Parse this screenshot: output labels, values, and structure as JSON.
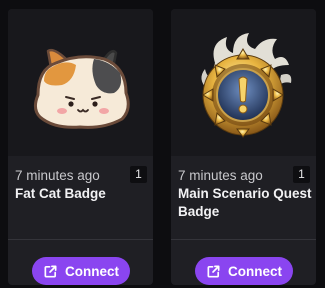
{
  "colors": {
    "background": "#0d0d10",
    "card": "#1f1f24",
    "accent": "#8a45f0"
  },
  "cards": [
    {
      "time": "7 minutes ago",
      "count": "1",
      "title": "Fat Cat Badge",
      "image_icon": "fat-cat-badge-icon",
      "button_icon": "external-link-icon",
      "button_label": "Connect"
    },
    {
      "time": "7 minutes ago",
      "count": "1",
      "title": "Main Scenario Quest Badge",
      "image_icon": "main-scenario-quest-badge-icon",
      "button_icon": "external-link-icon",
      "button_label": "Connect"
    }
  ]
}
